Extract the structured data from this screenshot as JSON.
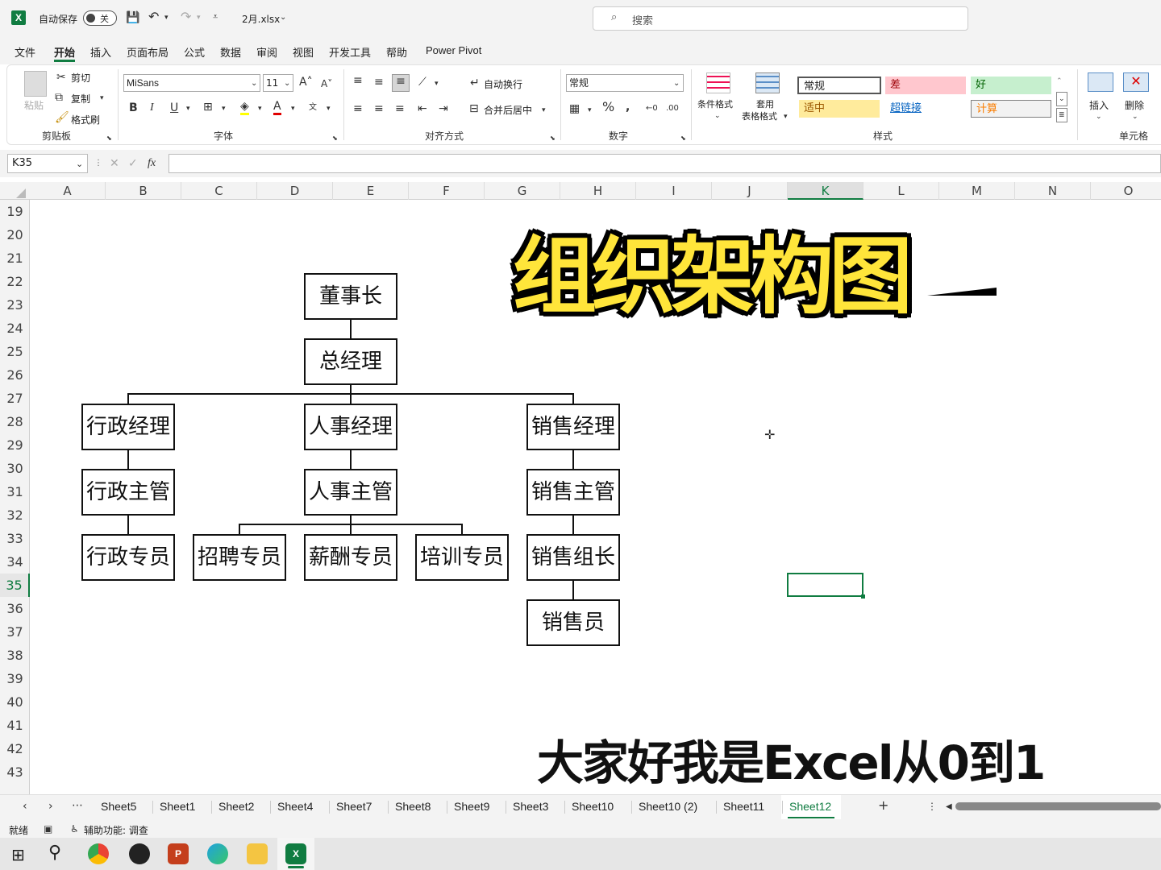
{
  "titlebar": {
    "autosave_label": "自动保存",
    "autosave_state": "关",
    "filename": "2月.xlsx",
    "search_placeholder": "搜索"
  },
  "menu": {
    "items": [
      "文件",
      "开始",
      "插入",
      "页面布局",
      "公式",
      "数据",
      "审阅",
      "视图",
      "开发工具",
      "帮助",
      "Power Pivot"
    ],
    "active": "开始"
  },
  "ribbon": {
    "clipboard": {
      "paste": "粘贴",
      "cut": "剪切",
      "copy": "复制",
      "format_painter": "格式刷",
      "label": "剪贴板"
    },
    "font": {
      "name": "MiSans",
      "size": "11",
      "label": "字体"
    },
    "alignment": {
      "wrap": "自动换行",
      "merge": "合并后居中",
      "label": "对齐方式"
    },
    "number": {
      "format": "常规",
      "label": "数字"
    },
    "styles": {
      "conditional": "条件格式",
      "table_a": "套用",
      "table_b": "表格格式",
      "normal": "常规",
      "bad": "差",
      "good": "好",
      "neutral": "适中",
      "hyperlink": "超链接",
      "calc": "计算",
      "label": "样式"
    },
    "cells": {
      "insert": "插入",
      "delete": "删除",
      "label": "单元格"
    }
  },
  "formula_bar": {
    "name_box": "K35",
    "fx": "fx",
    "value": ""
  },
  "columns": [
    "A",
    "B",
    "C",
    "D",
    "E",
    "F",
    "G",
    "H",
    "I",
    "J",
    "K",
    "L",
    "M",
    "N",
    "O"
  ],
  "selected_column": "K",
  "rows": [
    "19",
    "20",
    "21",
    "22",
    "23",
    "24",
    "25",
    "26",
    "27",
    "28",
    "29",
    "30",
    "31",
    "32",
    "33",
    "34",
    "35",
    "36",
    "37",
    "38",
    "39",
    "40",
    "41",
    "42",
    "43"
  ],
  "selected_row": "35",
  "org": {
    "chairman": "董事长",
    "gm": "总经理",
    "admin_mgr": "行政经理",
    "hr_mgr": "人事经理",
    "sales_mgr": "销售经理",
    "admin_sup": "行政主管",
    "hr_sup": "人事主管",
    "sales_sup": "销售主管",
    "admin_staff": "行政专员",
    "recruit": "招聘专员",
    "payroll": "薪酬专员",
    "training": "培训专员",
    "sales_lead": "销售组长",
    "sales_rep": "销售员"
  },
  "overlay": {
    "title": "组织架构图",
    "subtitle": "大家好我是Excel从0到1"
  },
  "sheets": [
    "Sheet5",
    "Sheet1",
    "Sheet2",
    "Sheet4",
    "Sheet7",
    "Sheet8",
    "Sheet9",
    "Sheet3",
    "Sheet10",
    "Sheet10 (2)",
    "Sheet11",
    "Sheet12"
  ],
  "active_sheet": "Sheet12",
  "status": {
    "ready": "就绪",
    "accessibility": "辅助功能: 调查"
  },
  "colors": {
    "excel_green": "#107c41",
    "title_yellow": "#ffe53a",
    "bad_bg": "#ffc7ce",
    "good_bg": "#c6efce",
    "neutral_bg": "#ffeb9c"
  }
}
